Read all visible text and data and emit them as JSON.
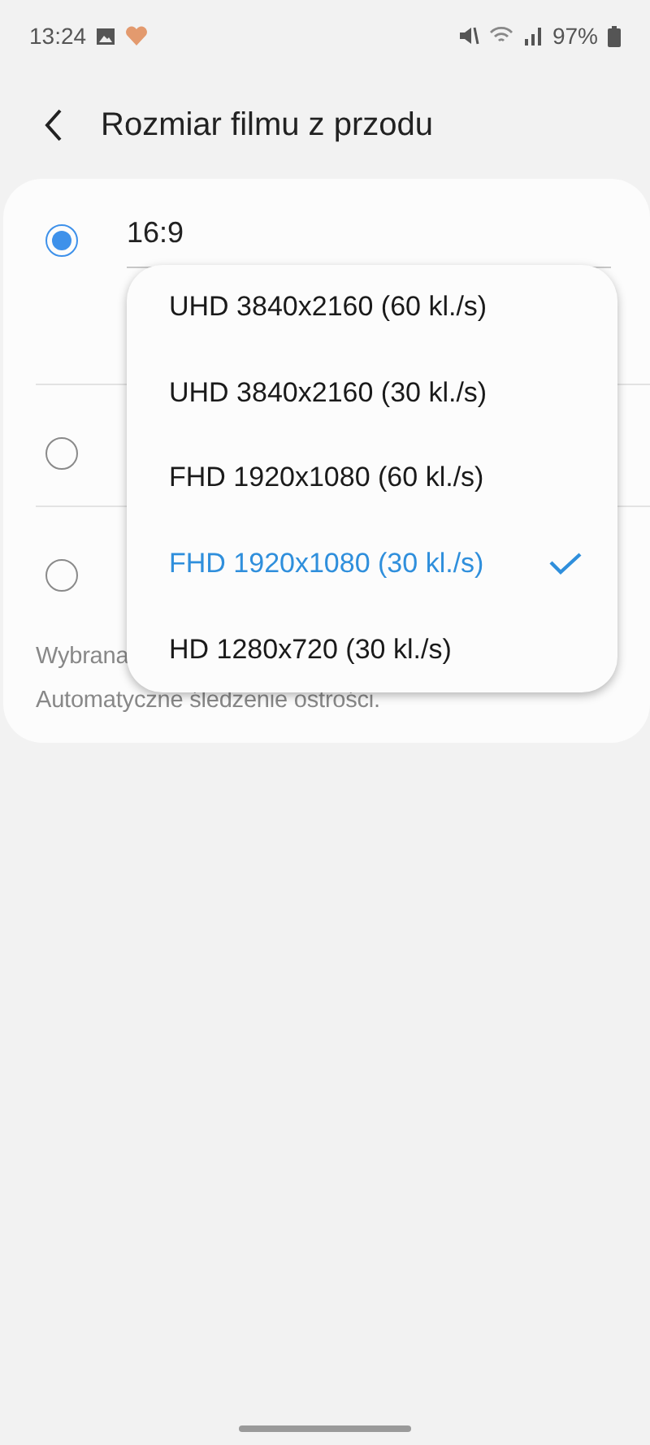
{
  "status_bar": {
    "time": "13:24",
    "battery": "97%"
  },
  "header": {
    "title": "Rozmiar filmu z przodu"
  },
  "options": [
    {
      "label": "16:9",
      "selected": true
    },
    {
      "selected": false
    },
    {
      "selected": false
    }
  ],
  "description": [
    "Wybrana",
    "Automatyczne śledzenie ostrości."
  ],
  "menu": [
    {
      "label": "UHD 3840x2160 (60 kl./s)",
      "selected": false
    },
    {
      "label": "UHD 3840x2160 (30 kl./s)",
      "selected": false
    },
    {
      "label": "FHD 1920x1080 (60 kl./s)",
      "selected": false
    },
    {
      "label": "FHD 1920x1080 (30 kl./s)",
      "selected": true
    },
    {
      "label": "HD 1280x720 (30 kl./s)",
      "selected": false
    }
  ]
}
